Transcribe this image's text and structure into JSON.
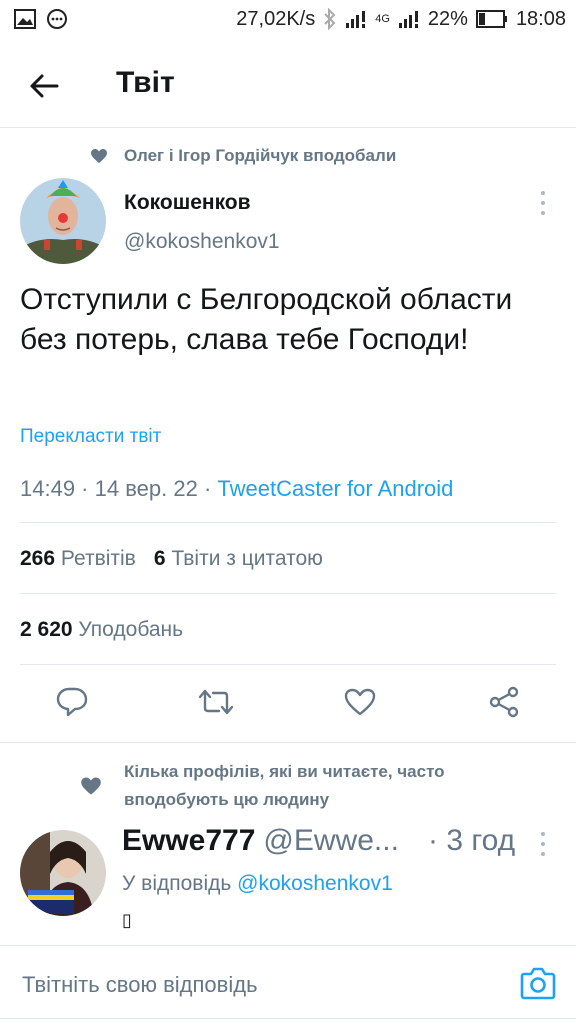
{
  "status_bar": {
    "speed": "27,02K/s",
    "network": "4G",
    "battery": "22%",
    "time": "18:08"
  },
  "header": {
    "title": "Твіт"
  },
  "tweet": {
    "social_context": "Олег і Ігор Гордійчук вподобали",
    "author_name": "Кокошенков",
    "author_handle": "@kokoshenkov1",
    "text": "Отступили с Белгородской области без потерь, слава тебе Господи!",
    "translate_label": "Перекласти твіт",
    "time": "14:49",
    "date": "14 вер. 22",
    "source": "TweetCaster for Android",
    "retweets_count": "266",
    "retweets_label": "Ретвітів",
    "quotes_count": "6",
    "quotes_label": "Твіти з цитатою",
    "likes_count": "2 620",
    "likes_label": "Уподобань"
  },
  "reply": {
    "social_context": "Кілька профілів, які ви читаєте, часто вподобують цю людину",
    "author_name": "Ewwe777",
    "author_handle": "@Ewwe...",
    "time": "· 3 год",
    "reply_to_prefix": "У відповідь",
    "reply_to_handle": "@kokoshenkov1",
    "text": "▯"
  },
  "compose": {
    "placeholder": "Твітніть свою відповідь"
  },
  "colors": {
    "accent": "#1da1f2",
    "secondary_text": "#657786",
    "divider": "#e1e8ed"
  },
  "icons": [
    "image-icon",
    "message-icon",
    "bluetooth-icon",
    "signal-icon",
    "battery-icon",
    "back-arrow-icon",
    "heart-icon",
    "more-icon",
    "reply-icon",
    "retweet-icon",
    "like-icon",
    "share-icon",
    "camera-icon"
  ]
}
